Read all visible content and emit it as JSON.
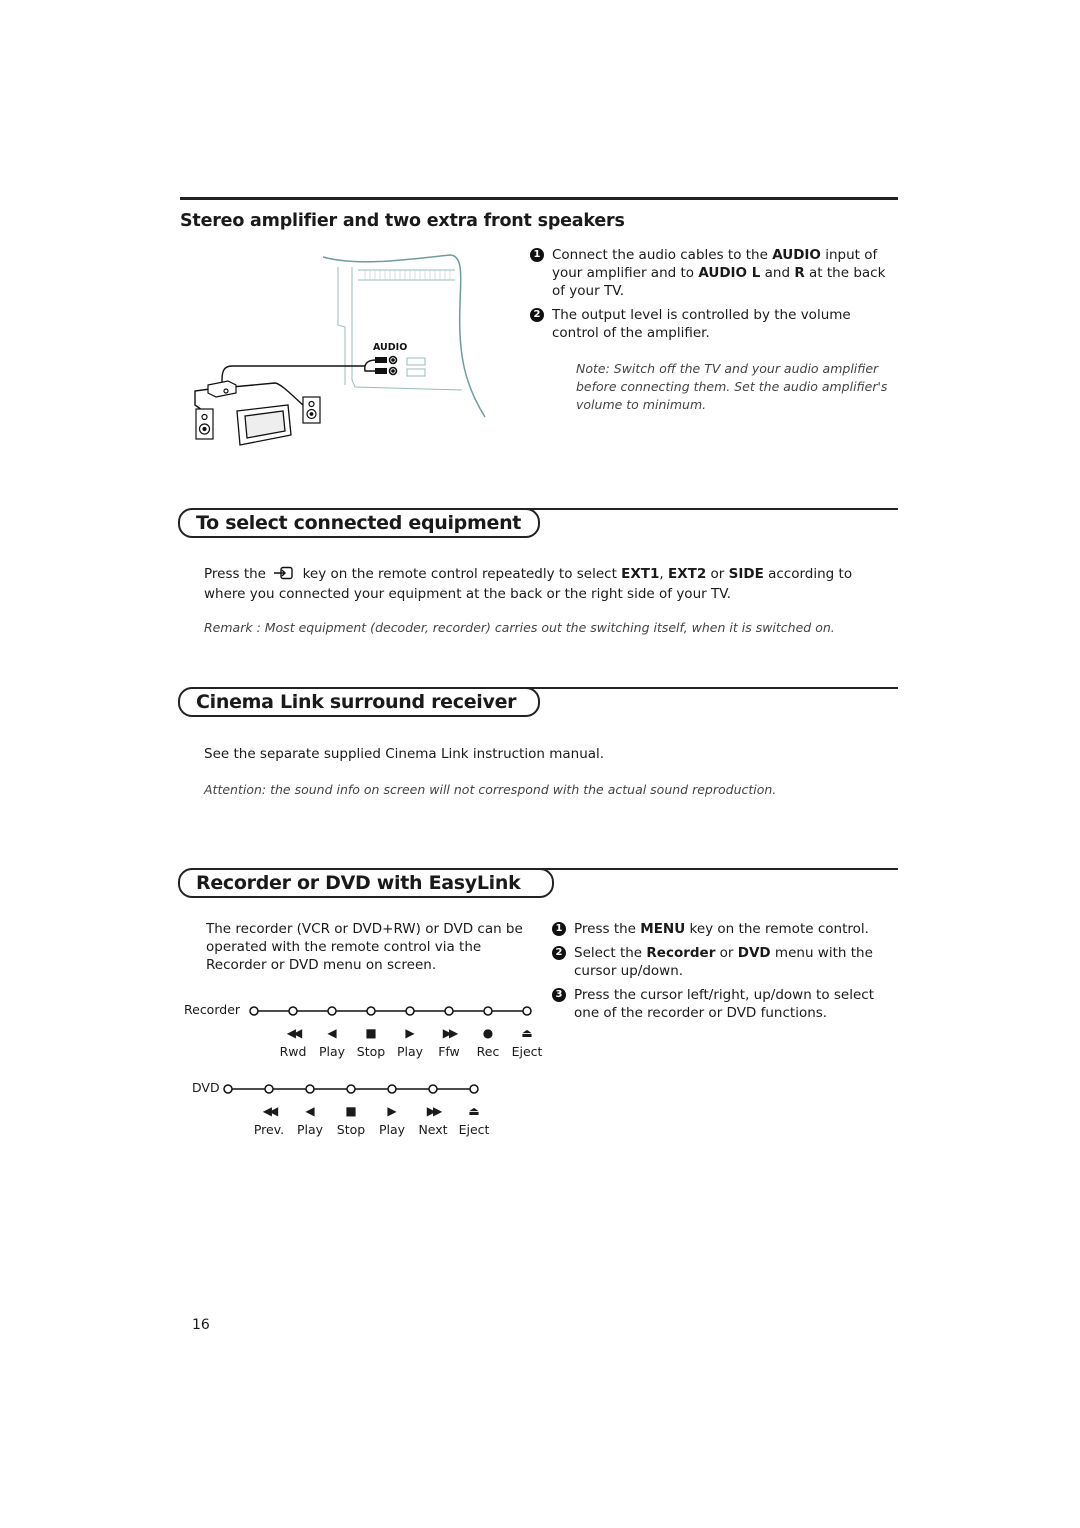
{
  "page_number": "16",
  "section_stereo": {
    "title": "Stereo amplifier and two extra front speakers",
    "diagram": {
      "audio_label": "AUDIO"
    },
    "steps": [
      {
        "num": "1",
        "parts": [
          "Connect the audio cables to the ",
          "AUDIO",
          " input of your amplifier and to ",
          "AUDIO L",
          " and ",
          "R",
          " at the back of your TV."
        ]
      },
      {
        "num": "2",
        "text": "The output level is controlled by the volume control of the amplifier."
      }
    ],
    "note": "Note: Switch off the TV and your audio amplifier before connecting them. Set the audio amplifier's volume to minimum."
  },
  "section_select": {
    "title": "To select connected equipment",
    "body_parts": [
      "Press the ",
      " key on the remote control repeatedly to select ",
      "EXT1",
      ", ",
      "EXT2",
      " or ",
      "SIDE",
      " according to where you connected your equipment at the back or the right side of your TV."
    ],
    "key_icon": "source-input-icon",
    "remark": "Remark : Most equipment (decoder, recorder) carries out the switching itself, when it is switched on."
  },
  "section_cinema": {
    "title": "Cinema Link surround receiver",
    "body": "See the separate supplied Cinema Link instruction manual.",
    "attention": "Attention: the sound info on screen will not correspond with the actual sound reproduction."
  },
  "section_easylink": {
    "title": "Recorder or DVD with EasyLink",
    "intro": "The recorder (VCR or DVD+RW) or DVD can be operated with the remote control via the Recorder or DVD menu on screen.",
    "steps": [
      {
        "num": "1",
        "parts": [
          "Press the ",
          "MENU",
          " key on the remote control."
        ]
      },
      {
        "num": "2",
        "parts": [
          "Select the ",
          "Recorder",
          " or ",
          "DVD",
          " menu with the cursor up/down."
        ]
      },
      {
        "num": "3",
        "text": "Press the cursor left/right, up/down to select one of the recorder or DVD functions."
      }
    ],
    "recorder_menu": {
      "label": "Recorder",
      "functions": [
        {
          "symbol": "◀◀",
          "label": "Rwd"
        },
        {
          "symbol": "◀",
          "label": "Play"
        },
        {
          "symbol": "■",
          "label": "Stop"
        },
        {
          "symbol": "▶",
          "label": "Play"
        },
        {
          "symbol": "▶▶",
          "label": "Ffw"
        },
        {
          "symbol": "●",
          "label": "Rec"
        },
        {
          "symbol": "⏏",
          "label": "Eject"
        }
      ]
    },
    "dvd_menu": {
      "label": "DVD",
      "functions": [
        {
          "symbol": "◀◀",
          "label": "Prev."
        },
        {
          "symbol": "◀",
          "label": "Play"
        },
        {
          "symbol": "■",
          "label": "Stop"
        },
        {
          "symbol": "▶",
          "label": "Play"
        },
        {
          "symbol": "▶▶",
          "label": "Next"
        },
        {
          "symbol": "⏏",
          "label": "Eject"
        }
      ]
    }
  }
}
